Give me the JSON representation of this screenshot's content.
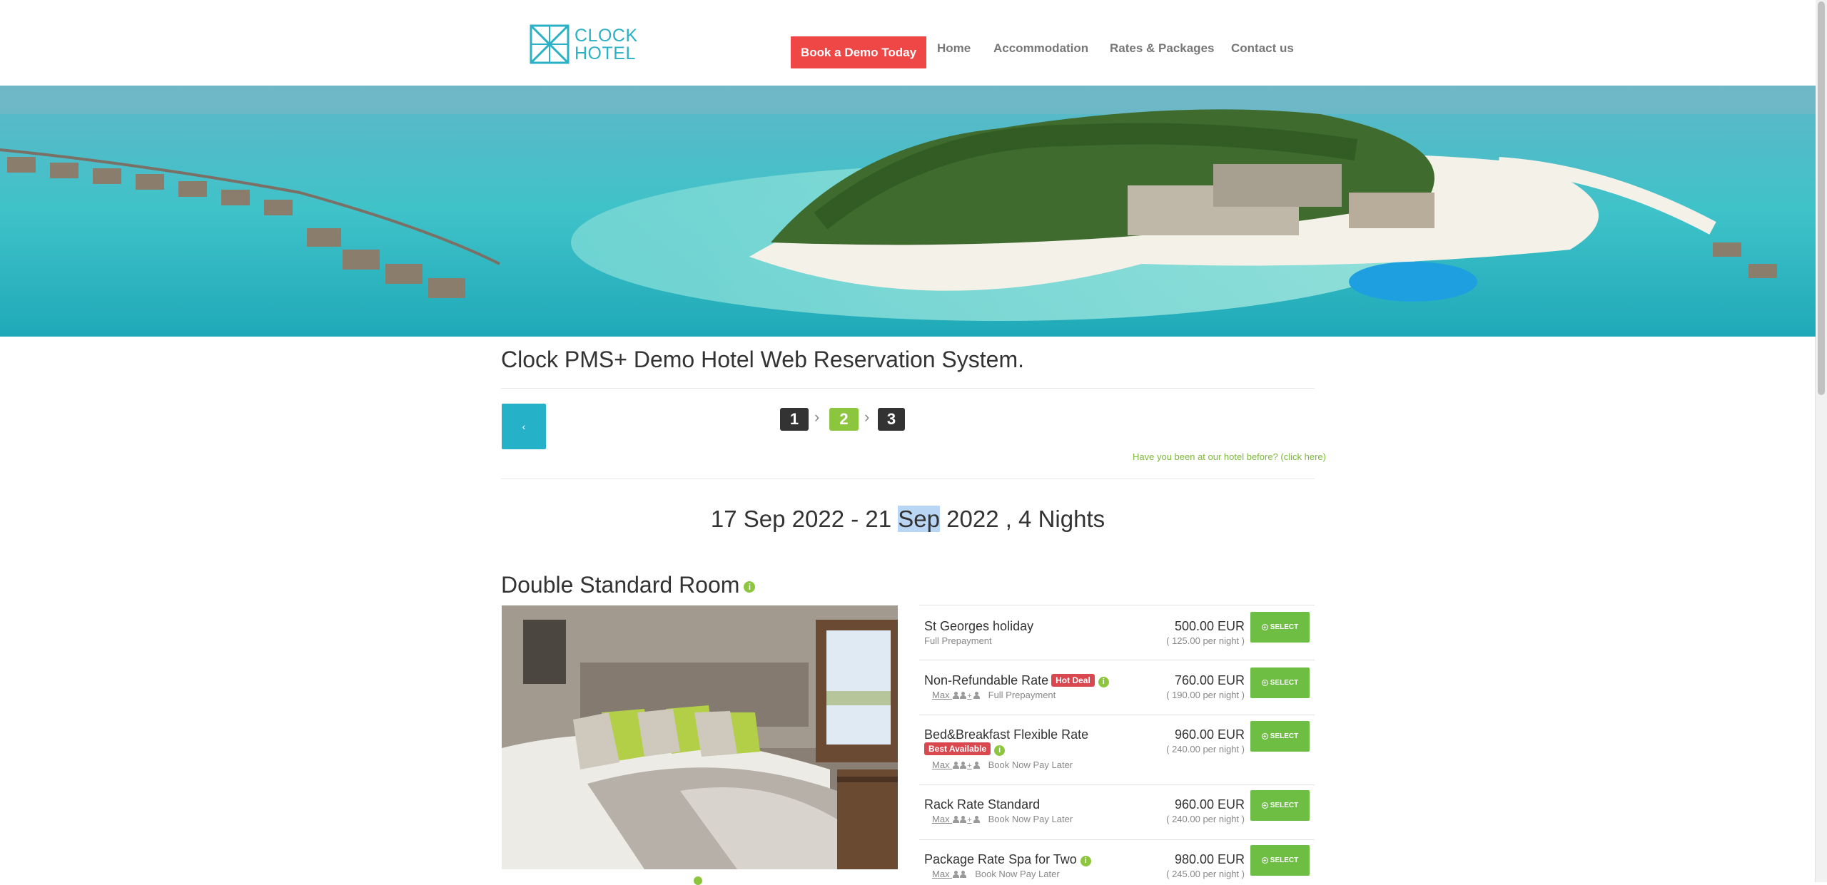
{
  "header": {
    "logo_line1": "CLOCK",
    "logo_line2": "HOTEL",
    "demo_button": "Book a Demo Today",
    "nav": [
      "Home",
      "Accommodation",
      "Rates & Packages",
      "Contact us"
    ]
  },
  "page_title": "Clock PMS+ Demo Hotel Web Reservation System.",
  "back_button": "‹",
  "steps": [
    "1",
    "2",
    "3"
  ],
  "active_step": "2",
  "returning_link": "Have you been at our hotel before? (click here)",
  "dates": {
    "before": "17 Sep 2022 - 21 ",
    "highlighted": "Sep",
    "after": " 2022 , 4 Nights"
  },
  "room": {
    "title": "Double Standard Room",
    "info_icon": "i",
    "rates": [
      {
        "name": "St Georges holiday",
        "badge": "",
        "max": "",
        "plan": "Full Prepayment",
        "price": "500.00 EUR",
        "per_night": "( 125.00 per night )",
        "select": "SELECT"
      },
      {
        "name": "Non-Refundable Rate",
        "badge": "Hot Deal",
        "max": "Max",
        "plan": "Full Prepayment",
        "price": "760.00 EUR",
        "per_night": "( 190.00 per night )",
        "select": "SELECT"
      },
      {
        "name": "Bed&Breakfast Flexible Rate",
        "badge": "Best Available",
        "max": "Max",
        "plan": "Book Now Pay Later",
        "price": "960.00 EUR",
        "per_night": "( 240.00 per night )",
        "select": "SELECT"
      },
      {
        "name": "Rack Rate Standard",
        "badge": "",
        "max": "Max",
        "plan": "Book Now Pay Later",
        "price": "960.00 EUR",
        "per_night": "( 240.00 per night )",
        "select": "SELECT"
      },
      {
        "name": "Package Rate Spa for Two",
        "badge": "",
        "max": "Max",
        "plan": "Book Now Pay Later",
        "price": "980.00 EUR",
        "per_night": "( 245.00 per night )",
        "select": "SELECT"
      }
    ]
  },
  "colors": {
    "brand_teal": "#25b2c9",
    "demo_red": "#ef4646",
    "accent_green": "#8cc63f",
    "select_green": "#6ebe44",
    "badge_red": "#d9484e"
  }
}
